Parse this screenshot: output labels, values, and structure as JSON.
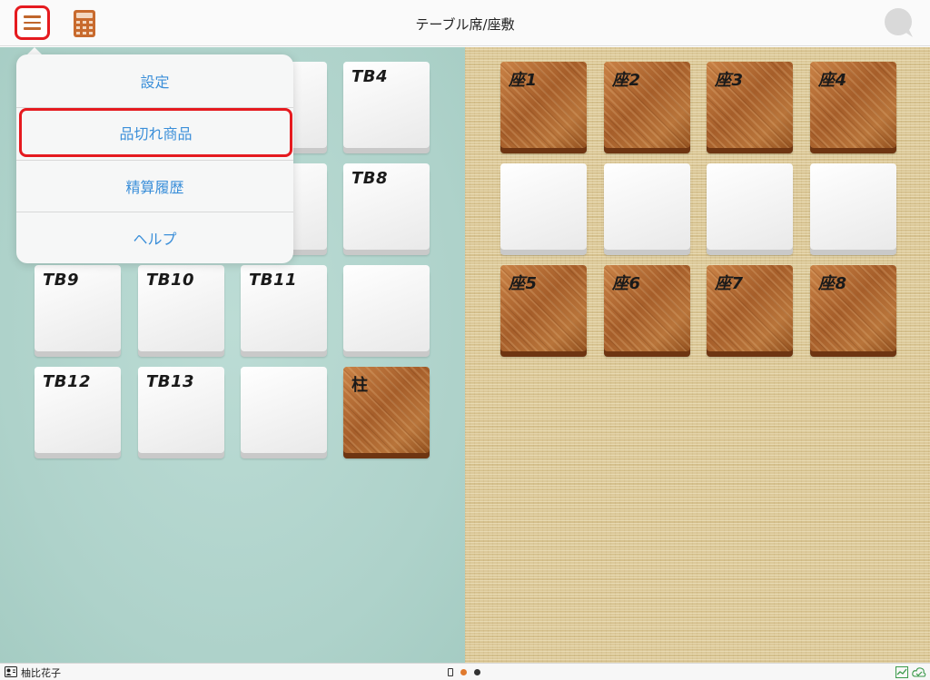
{
  "header": {
    "title": "テーブル席/座敷",
    "menu_icon": "hamburger-menu-icon",
    "calculator_icon": "calculator-icon",
    "chat_icon": "chat-bubble-icon"
  },
  "menu": {
    "items": [
      {
        "label": "設定"
      },
      {
        "label": "品切れ商品",
        "highlighted": true
      },
      {
        "label": "精算履歴"
      },
      {
        "label": "ヘルプ"
      }
    ]
  },
  "table_area": {
    "tiles": [
      {
        "label": "TB4",
        "style": "white"
      },
      {
        "label": "TB8",
        "style": "white"
      },
      {
        "label": "TB9",
        "style": "white"
      },
      {
        "label": "TB10",
        "style": "white"
      },
      {
        "label": "TB11",
        "style": "white"
      },
      {
        "label": "",
        "style": "white"
      },
      {
        "label": "TB12",
        "style": "white"
      },
      {
        "label": "TB13",
        "style": "white"
      },
      {
        "label": "",
        "style": "white"
      },
      {
        "label": "柱",
        "style": "wood"
      }
    ]
  },
  "tatami_area": {
    "tiles": [
      {
        "label": "座1",
        "style": "wood"
      },
      {
        "label": "座2",
        "style": "wood"
      },
      {
        "label": "座3",
        "style": "wood"
      },
      {
        "label": "座4",
        "style": "wood"
      },
      {
        "label": "",
        "style": "white"
      },
      {
        "label": "",
        "style": "white"
      },
      {
        "label": "",
        "style": "white"
      },
      {
        "label": "",
        "style": "white"
      },
      {
        "label": "座5",
        "style": "wood"
      },
      {
        "label": "座6",
        "style": "wood"
      },
      {
        "label": "座7",
        "style": "wood"
      },
      {
        "label": "座8",
        "style": "wood"
      }
    ]
  },
  "footer": {
    "user_name": "柚比花子",
    "page_indicator_colors": [
      "#e07a2e",
      "#333333"
    ]
  },
  "colors": {
    "accent_red": "#e51a1f",
    "menu_text_blue": "#3b8fd9",
    "icon_orange": "#c0662c"
  }
}
